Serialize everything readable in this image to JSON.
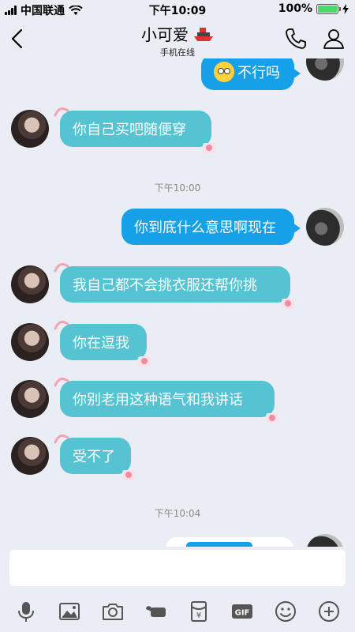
{
  "status_bar": {
    "carrier": "中国联通",
    "time": "下午10:09",
    "battery": "100%"
  },
  "header": {
    "title": "小可爱",
    "subtitle": "手机在线"
  },
  "messages": [
    {
      "side": "out",
      "text": "不行吗"
    },
    {
      "side": "in",
      "text": "你自己买吧随便穿"
    },
    {
      "side": "time",
      "text": "下午10:00"
    },
    {
      "side": "out",
      "text": "你到底什么意思啊现在"
    },
    {
      "side": "in",
      "text": "我自己都不会挑衣服还帮你挑"
    },
    {
      "side": "in",
      "text": "你在逗我"
    },
    {
      "side": "in",
      "text": "你别老用这种语气和我讲话"
    },
    {
      "side": "in",
      "text": "受不了"
    },
    {
      "side": "time",
      "text": "下午10:04"
    }
  ],
  "input": {
    "placeholder": ""
  },
  "toolbar": {
    "gif_label": "GIF",
    "hongbao_label": "¥"
  },
  "colors": {
    "bubble_in": "#55c3d2",
    "bubble_out": "#15a0e8",
    "background": "#eaedf3"
  }
}
